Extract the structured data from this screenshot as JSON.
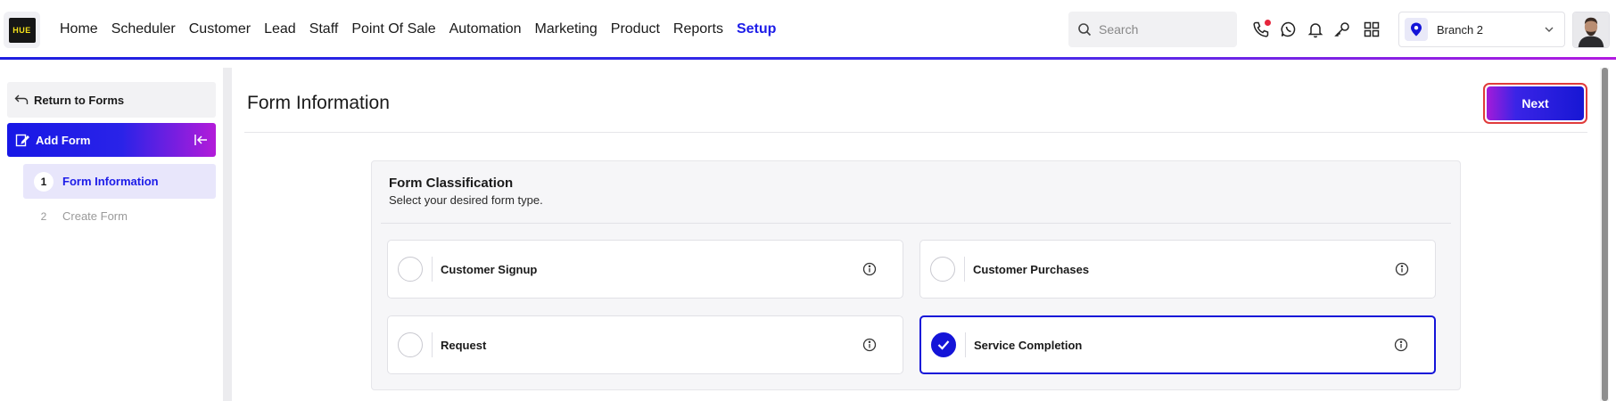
{
  "logo": {
    "text": "HUE",
    "alt": "FITNESS HUE"
  },
  "nav": {
    "items": [
      {
        "label": "Home",
        "active": false
      },
      {
        "label": "Scheduler",
        "active": false
      },
      {
        "label": "Customer",
        "active": false
      },
      {
        "label": "Lead",
        "active": false
      },
      {
        "label": "Staff",
        "active": false
      },
      {
        "label": "Point Of Sale",
        "active": false
      },
      {
        "label": "Automation",
        "active": false
      },
      {
        "label": "Marketing",
        "active": false
      },
      {
        "label": "Product",
        "active": false
      },
      {
        "label": "Reports",
        "active": false
      },
      {
        "label": "Setup",
        "active": true
      }
    ]
  },
  "search": {
    "placeholder": "Search",
    "value": ""
  },
  "toolbar_icons": [
    "phone-icon",
    "whatsapp-icon",
    "bell-icon",
    "key-icon",
    "grid-icon"
  ],
  "branch": {
    "label": "Branch 2"
  },
  "sidebar": {
    "return_label": "Return to Forms",
    "section_label": "Add Form",
    "steps": [
      {
        "number": "1",
        "label": "Form Information",
        "active": true
      },
      {
        "number": "2",
        "label": "Create Form",
        "active": false
      }
    ]
  },
  "main": {
    "title": "Form Information",
    "next_label": "Next",
    "classification": {
      "title": "Form Classification",
      "subtitle": "Select your desired form type.",
      "options": [
        {
          "label": "Customer Signup",
          "selected": false
        },
        {
          "label": "Customer Purchases",
          "selected": false
        },
        {
          "label": "Request",
          "selected": false
        },
        {
          "label": "Service Completion",
          "selected": true
        }
      ]
    }
  },
  "colors": {
    "accent": "#1c1ce8",
    "gradient_start": "#1717e6",
    "gradient_end": "#b31bd9",
    "notification_dot": "#e6253c",
    "next_border": "#e03b3b"
  }
}
